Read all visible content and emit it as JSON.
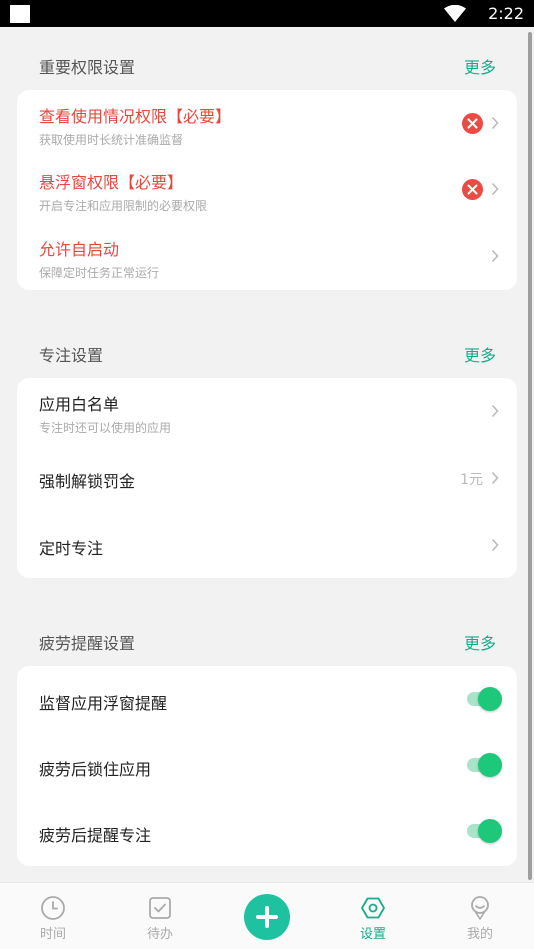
{
  "status_bar": {
    "time": "2:22"
  },
  "sections": {
    "permissions": {
      "title": "重要权限设置",
      "more": "更多",
      "items": [
        {
          "title": "查看使用情况权限【必要】",
          "subtitle": "获取使用时长统计准确监督"
        },
        {
          "title": "悬浮窗权限【必要】",
          "subtitle": "开启专注和应用限制的必要权限"
        },
        {
          "title": "允许自启动",
          "subtitle": "保障定时任务正常运行"
        }
      ]
    },
    "focus": {
      "title": "专注设置",
      "more": "更多",
      "items": [
        {
          "title": "应用白名单",
          "subtitle": "专注时还可以使用的应用"
        },
        {
          "title": "强制解锁罚金",
          "value": "1元"
        },
        {
          "title": "定时专注"
        }
      ]
    },
    "fatigue": {
      "title": "疲劳提醒设置",
      "more": "更多",
      "items": [
        {
          "title": "监督应用浮窗提醒",
          "enabled": true
        },
        {
          "title": "疲劳后锁住应用",
          "enabled": true
        },
        {
          "title": "疲劳后提醒专注",
          "enabled": true
        }
      ]
    }
  },
  "bottom_nav": {
    "items": [
      {
        "label": "时间",
        "icon": "clock-icon"
      },
      {
        "label": "待办",
        "icon": "checkbox-icon"
      },
      {
        "label": "设置",
        "icon": "hexagon-settings-icon",
        "active": true
      },
      {
        "label": "我的",
        "icon": "profile-icon"
      }
    ],
    "fab_icon": "plus-icon"
  },
  "colors": {
    "accent": "#1aab8a",
    "required_red": "#e8473e",
    "toggle_on": "#1ec87a",
    "background": "#f2f2f2"
  }
}
